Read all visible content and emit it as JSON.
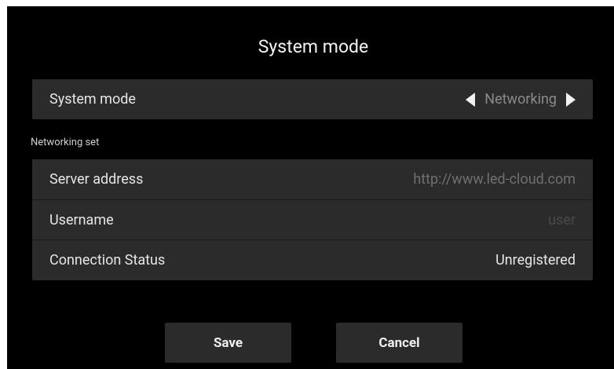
{
  "dialog": {
    "title": "System mode"
  },
  "mode_row": {
    "label": "System mode",
    "value": "Networking",
    "prev_icon": "triangle-left-icon",
    "next_icon": "triangle-right-icon"
  },
  "networking": {
    "section_label": "Networking set",
    "rows": [
      {
        "label": "Server address",
        "value": "http://www.led-cloud.com"
      },
      {
        "label": "Username",
        "value": "user"
      },
      {
        "label": "Connection Status",
        "value": "Unregistered"
      }
    ]
  },
  "actions": {
    "save_label": "Save",
    "cancel_label": "Cancel"
  },
  "colors": {
    "background": "#000000",
    "row": "#2b2b2b",
    "text": "#e6e6e6"
  }
}
